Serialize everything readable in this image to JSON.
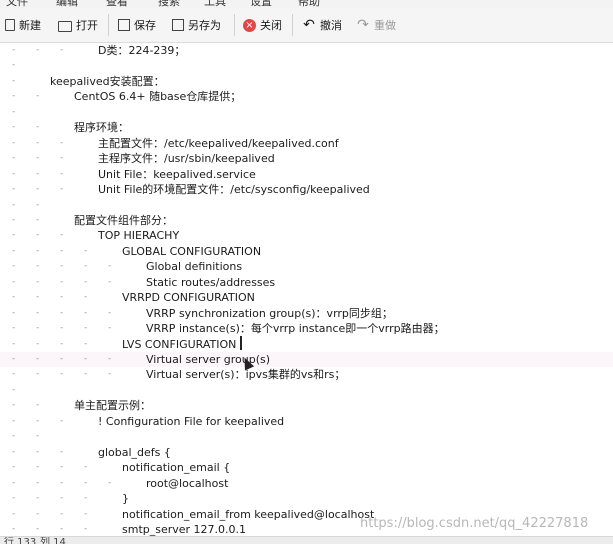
{
  "menu": [
    "文件",
    "编辑",
    "查看",
    "搜索",
    "工具",
    "设置",
    "帮助"
  ],
  "toolbar": {
    "new": "新建",
    "open": "打开",
    "save": "保存",
    "save_as": "另存为",
    "close": "关闭",
    "undo": "撤消",
    "redo": "重做"
  },
  "lines": [
    {
      "indent": 3,
      "text": "D类：224-239；"
    },
    {
      "indent": 0,
      "text": ""
    },
    {
      "indent": 1,
      "text": "keepalived安装配置："
    },
    {
      "indent": 2,
      "text": "CentOS 6.4+ 随base仓库提供；"
    },
    {
      "indent": 1,
      "text": ""
    },
    {
      "indent": 2,
      "text": "程序环境："
    },
    {
      "indent": 3,
      "text": "主配置文件：/etc/keepalived/keepalived.conf"
    },
    {
      "indent": 3,
      "text": "主程序文件：/usr/sbin/keepalived"
    },
    {
      "indent": 3,
      "text": "Unit File：keepalived.service"
    },
    {
      "indent": 3,
      "text": "Unit File的环境配置文件：/etc/sysconfig/keepalived"
    },
    {
      "indent": 2,
      "text": ""
    },
    {
      "indent": 2,
      "text": "配置文件组件部分："
    },
    {
      "indent": 3,
      "text": "TOP HIERACHY"
    },
    {
      "indent": 4,
      "text": "GLOBAL CONFIGURATION"
    },
    {
      "indent": 5,
      "text": "Global definitions"
    },
    {
      "indent": 5,
      "text": "Static routes/addresses"
    },
    {
      "indent": 4,
      "text": "VRRPD CONFIGURATION"
    },
    {
      "indent": 5,
      "text": "VRRP synchronization group(s)：vrrp同步组；"
    },
    {
      "indent": 5,
      "text": "VRRP instance(s)：每个vrrp instance即一个vrrp路由器；"
    },
    {
      "indent": 4,
      "text": "LVS CONFIGURATION"
    },
    {
      "indent": 5,
      "text": "Virtual server group(s)"
    },
    {
      "indent": 5,
      "text": "Virtual server(s)：ipvs集群的vs和rs；"
    },
    {
      "indent": 1,
      "text": ""
    },
    {
      "indent": 2,
      "text": "单主配置示例："
    },
    {
      "indent": 3,
      "text": "! Configuration File for keepalived"
    },
    {
      "indent": 2,
      "text": ""
    },
    {
      "indent": 3,
      "text": "global_defs {"
    },
    {
      "indent": 4,
      "text": "notification_email {"
    },
    {
      "indent": 5,
      "text": "root@localhost"
    },
    {
      "indent": 4,
      "text": "}"
    },
    {
      "indent": 4,
      "text": "notification_email_from keepalived@localhost"
    },
    {
      "indent": 4,
      "text": "smtp_server 127.0.0.1"
    }
  ],
  "current_line": 20,
  "status": {
    "row": "行 133",
    "col": "列 14"
  },
  "watermark": "https://blog.csdn.net/qq_42227818"
}
